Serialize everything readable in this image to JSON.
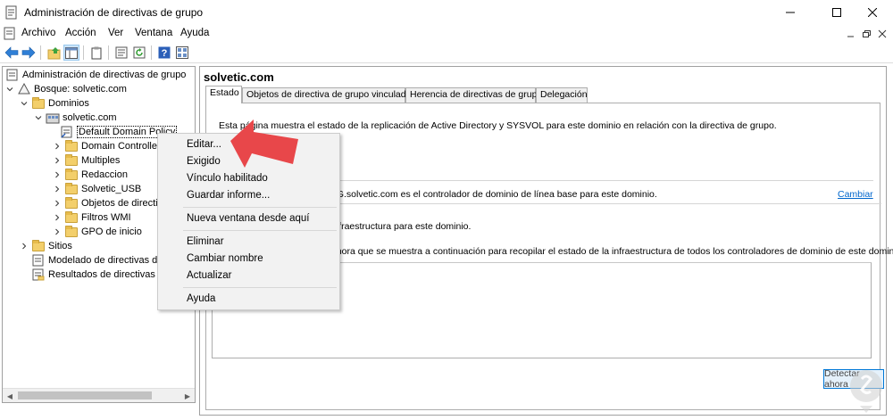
{
  "window": {
    "title": "Administración de directivas de grupo"
  },
  "menubar": {
    "items": [
      "Archivo",
      "Acción",
      "Ver",
      "Ventana",
      "Ayuda"
    ]
  },
  "toolbar": {
    "buttons": [
      "back-icon",
      "forward-icon",
      "up-folder-icon",
      "show-hide-tree-icon",
      "clipboard-icon",
      "properties-icon",
      "refresh-icon",
      "help-icon",
      "mmc-view-icon"
    ]
  },
  "tree": {
    "root": "Administración de directivas de grupo",
    "forest": "Bosque: solvetic.com",
    "domains": "Dominios",
    "domain": "solvetic.com",
    "items": [
      "Default Domain Policy",
      "Domain Controllers",
      "Multiples",
      "Redaccion",
      "Solvetic_USB",
      "Objetos de directiva",
      "Filtros WMI",
      "GPO de inicio"
    ],
    "sites": "Sitios",
    "modeling": "Modelado de directivas d",
    "results": "Resultados de directivas d"
  },
  "right": {
    "title": "solvetic.com",
    "tabs": [
      "Estado",
      "Objetos de directiva de grupo vinculados",
      "Herencia de directivas de grupo",
      "Delegación"
    ],
    "description": "Esta página muestra el estado de la replicación de Active Directory y SYSVOL para este dominio en relación con la directiva de grupo.",
    "baseline_text": "3G.solvetic.com es el controlador de dominio de línea base para este dominio.",
    "change_link": "Cambiar",
    "infra_text": "infraestructura para este dominio.",
    "detect_text": "ahora que se muestra a continuación para recopilar el estado de la infraestructura de todos los controladores de dominio de este dominio.",
    "detect_button": "Detectar ahora"
  },
  "context_menu": {
    "items": [
      "Editar...",
      "Exigido",
      "Vínculo habilitado",
      "Guardar informe...",
      "Nueva ventana desde aquí",
      "Eliminar",
      "Cambiar nombre",
      "Actualizar",
      "Ayuda"
    ]
  },
  "colors": {
    "accent": "#0078d7",
    "arrow": "#e8474a",
    "link": "#0066cc",
    "folder": "#f3cf6b"
  }
}
